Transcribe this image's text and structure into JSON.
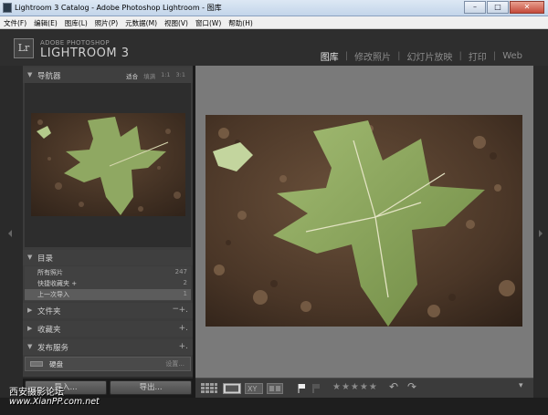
{
  "window": {
    "title": "Lightroom 3 Catalog - Adobe Photoshop Lightroom - 图库",
    "controls": {
      "minimize": "–",
      "maximize": "□",
      "close": "✕"
    }
  },
  "menubar": [
    "文件(F)",
    "编辑(E)",
    "图库(L)",
    "照片(P)",
    "元数据(M)",
    "视图(V)",
    "窗口(W)",
    "帮助(H)"
  ],
  "identity": {
    "logo": "Lr",
    "brand_small": "ADOBE PHOTOSHOP",
    "brand_big": "LIGHTROOM 3"
  },
  "modules": [
    "图库",
    "修改照片",
    "幻灯片放映",
    "打印",
    "Web"
  ],
  "active_module": "图库",
  "navigator": {
    "title": "导航器",
    "zoom_options": [
      "适合",
      "填满",
      "1:1",
      "3:1"
    ],
    "selected_zoom": "适合"
  },
  "catalog": {
    "title": "目录",
    "items": [
      {
        "label": "所有照片",
        "count": "247"
      },
      {
        "label": "快捷收藏夹 +",
        "count": "2"
      },
      {
        "label": "上一次导入",
        "count": "1"
      }
    ]
  },
  "folders": {
    "title": "文件夹",
    "actions": [
      "−",
      "+."
    ]
  },
  "collections": {
    "title": "收藏夹",
    "action": "+."
  },
  "publish": {
    "title": "发布服务",
    "action": "+.",
    "item_label": "硬盘",
    "item_setting": "设置..."
  },
  "buttons": {
    "import": "导入...",
    "export": "导出..."
  },
  "watermark": {
    "line1": "西安摄影论坛",
    "line2": "www.XianPP.com.net"
  },
  "toolbar": {
    "rating_stars": "★★★★★",
    "rotate_left": "↶",
    "rotate_right": "↷",
    "menu": "▾"
  }
}
